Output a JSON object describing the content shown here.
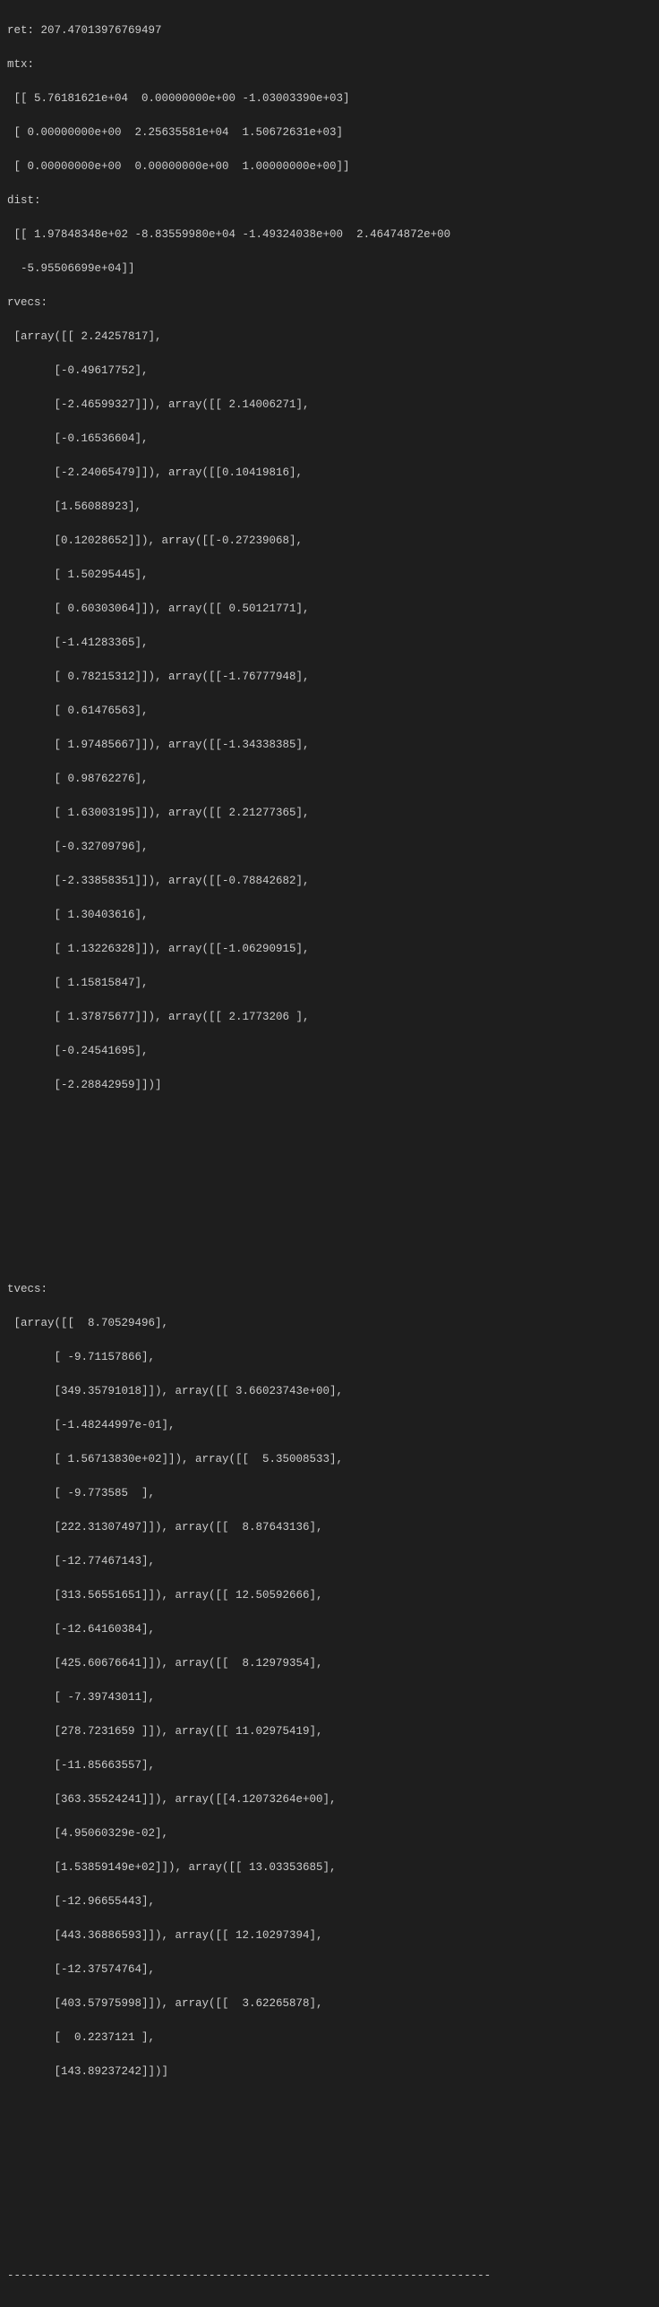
{
  "output": {
    "ret_label": "ret: ",
    "ret_value": "207.47013976769497",
    "mtx_label": "mtx:",
    "mtx_rows": [
      " [[ 5.76181621e+04  0.00000000e+00 -1.03003390e+03]",
      " [ 0.00000000e+00  2.25635581e+04  1.50672631e+03]",
      " [ 0.00000000e+00  0.00000000e+00  1.00000000e+00]]"
    ],
    "dist_label": "dist:",
    "dist_rows": [
      " [[ 1.97848348e+02 -8.83559980e+04 -1.49324038e+00  2.46474872e+00",
      "  -5.95506699e+04]]"
    ],
    "rvecs_label": "rvecs:",
    "rvecs_lines": [
      " [array([[ 2.24257817],",
      "       [-0.49617752],",
      "       [-2.46599327]]), array([[ 2.14006271],",
      "       [-0.16536604],",
      "       [-2.24065479]]), array([[0.10419816],",
      "       [1.56088923],",
      "       [0.12028652]]), array([[-0.27239068],",
      "       [ 1.50295445],",
      "       [ 0.60303064]]), array([[ 0.50121771],",
      "       [-1.41283365],",
      "       [ 0.78215312]]), array([[-1.76777948],",
      "       [ 0.61476563],",
      "       [ 1.97485667]]), array([[-1.34338385],",
      "       [ 0.98762276],",
      "       [ 1.63003195]]), array([[ 2.21277365],",
      "       [-0.32709796],",
      "       [-2.33858351]]), array([[-0.78842682],",
      "       [ 1.30403616],",
      "       [ 1.13226328]]), array([[-1.06290915],",
      "       [ 1.15815847],",
      "       [ 1.37875677]]), array([[ 2.1773206 ],",
      "       [-0.24541695],",
      "       [-2.28842959]])]"
    ],
    "tvecs_label": "tvecs:",
    "tvecs_lines": [
      " [array([[  8.70529496],",
      "       [ -9.71157866],",
      "       [349.35791018]]), array([[ 3.66023743e+00],",
      "       [-1.48244997e-01],",
      "       [ 1.56713830e+02]]), array([[  5.35008533],",
      "       [ -9.773585  ],",
      "       [222.31307497]]), array([[  8.87643136],",
      "       [-12.77467143],",
      "       [313.56551651]]), array([[ 12.50592666],",
      "       [-12.64160384],",
      "       [425.60676641]]), array([[  8.12979354],",
      "       [ -7.39743011],",
      "       [278.7231659 ]]), array([[ 11.02975419],",
      "       [-11.85663557],",
      "       [363.35524241]]), array([[4.12073264e+00],",
      "       [4.95060329e-02],",
      "       [1.53859149e+02]]), array([[ 13.03353685],",
      "       [-12.96655443],",
      "       [443.36886593]]), array([[ 12.10297394],",
      "       [-12.37574764],",
      "       [403.57975998]]), array([[  3.62265878],",
      "       [  0.2237121 ],",
      "       [143.89237242]])]"
    ],
    "separator": "------------------------------------------------------------------------"
  }
}
